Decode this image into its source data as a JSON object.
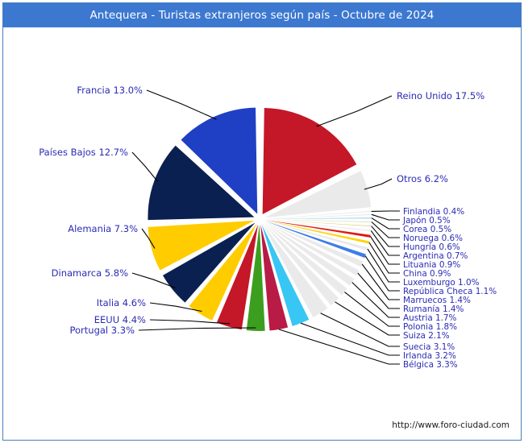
{
  "window": {
    "title": "Antequera - Turistas extranjeros según país - Octubre de 2024",
    "title_bar_color": "#3c78d0",
    "border_color": "#4a7ebb",
    "background": "#ffffff"
  },
  "footer": {
    "url": "http://www.foro-ciudad.com"
  },
  "labels": {
    "left": [
      {
        "key": "francia",
        "text": "Francia 13.0%"
      },
      {
        "key": "paises_bajos",
        "text": "Países Bajos 12.7%"
      },
      {
        "key": "alemania",
        "text": "Alemania 7.3%"
      },
      {
        "key": "dinamarca",
        "text": "Dinamarca 5.8%"
      },
      {
        "key": "italia",
        "text": "Italia 4.6%"
      },
      {
        "key": "eeuu",
        "text": "EEUU 4.4%"
      },
      {
        "key": "portugal",
        "text": "Portugal 3.3%"
      }
    ],
    "right_top": [
      {
        "key": "reino_unido",
        "text": "Reino Unido 17.5%"
      },
      {
        "key": "otros",
        "text": "Otros 6.2%"
      }
    ],
    "right_stack": [
      {
        "key": "finlandia",
        "text": "Finlandia 0.4%"
      },
      {
        "key": "japon",
        "text": "Japón 0.5%"
      },
      {
        "key": "corea",
        "text": "Corea 0.5%"
      },
      {
        "key": "noruega",
        "text": "Noruega 0.6%"
      },
      {
        "key": "hungria",
        "text": "Hungría 0.6%"
      },
      {
        "key": "argentina",
        "text": "Argentina 0.7%"
      },
      {
        "key": "lituania",
        "text": "Lituania 0.9%"
      },
      {
        "key": "china",
        "text": "China 0.9%"
      },
      {
        "key": "luxemburgo",
        "text": "Luxemburgo 1.0%"
      },
      {
        "key": "republica_checa",
        "text": "República Checa 1.1%"
      },
      {
        "key": "marruecos",
        "text": "Marruecos 1.4%"
      },
      {
        "key": "rumania",
        "text": "Rumanía 1.4%"
      },
      {
        "key": "austria",
        "text": "Austria 1.7%"
      },
      {
        "key": "polonia",
        "text": "Polonia 1.8%"
      },
      {
        "key": "suiza",
        "text": "Suiza 2.1%"
      },
      {
        "key": "suecia",
        "text": "Suecia 3.1%"
      },
      {
        "key": "irlanda",
        "text": "Irlanda 3.2%"
      },
      {
        "key": "belgica",
        "text": "Bélgica 3.3%"
      }
    ]
  },
  "chart_data": {
    "type": "pie",
    "title": "Antequera - Turistas extranjeros según país - Octubre de 2024",
    "units": "percent",
    "exploded": true,
    "start_angle_deg": 0,
    "direction": "clockwise",
    "categories": [
      "Reino Unido",
      "Otros",
      "Finlandia",
      "Japón",
      "Corea",
      "Noruega",
      "Hungría",
      "Argentina",
      "Lituania",
      "China",
      "Luxemburgo",
      "República Checa",
      "Marruecos",
      "Rumanía",
      "Austria",
      "Polonia",
      "Suiza",
      "Suecia",
      "Irlanda",
      "Bélgica",
      "Portugal",
      "EEUU",
      "Italia",
      "Dinamarca",
      "Alemania",
      "Países Bajos",
      "Francia"
    ],
    "values": [
      17.5,
      6.2,
      0.4,
      0.5,
      0.5,
      0.6,
      0.6,
      0.7,
      0.9,
      0.9,
      1.0,
      1.1,
      1.4,
      1.4,
      1.7,
      1.8,
      2.1,
      3.1,
      3.2,
      3.3,
      3.3,
      4.4,
      4.6,
      5.8,
      7.3,
      12.7,
      13.0
    ],
    "colors": [
      "#c41728",
      "#eaeaea",
      "#eaeaea",
      "#eaeaea",
      "#a8d8f0",
      "#c9c45e",
      "#c9c45e",
      "#eaeaea",
      "#e01b12",
      "#ffd400",
      "#eaeaea",
      "#3f7de8",
      "#eaeaea",
      "#eaeaea",
      "#eaeaea",
      "#eaeaea",
      "#eaeaea",
      "#eaeaea",
      "#38c6f4",
      "#b81b45",
      "#3c9e1e",
      "#c41728",
      "#ffcc00",
      "#0a2050",
      "#ffcc00",
      "#0a2050",
      "#1f40c4"
    ],
    "slice_labels": [
      "Reino Unido 17.5%",
      "Otros 6.2%",
      "Finlandia 0.4%",
      "Japón 0.5%",
      "Corea 0.5%",
      "Noruega 0.6%",
      "Hungría 0.6%",
      "Argentina 0.7%",
      "Lituania 0.9%",
      "China 0.9%",
      "Luxemburgo 1.0%",
      "República Checa 1.1%",
      "Marruecos 1.4%",
      "Rumanía 1.4%",
      "Austria 1.7%",
      "Polonia 1.8%",
      "Suiza 2.1%",
      "Suecia 3.1%",
      "Irlanda 3.2%",
      "Bélgica 3.3%",
      "Portugal 3.3%",
      "EEUU 4.4%",
      "Italia 4.6%",
      "Dinamarca 5.8%",
      "Alemania 7.3%",
      "Países Bajos 12.7%",
      "Francia 13.0%"
    ]
  }
}
